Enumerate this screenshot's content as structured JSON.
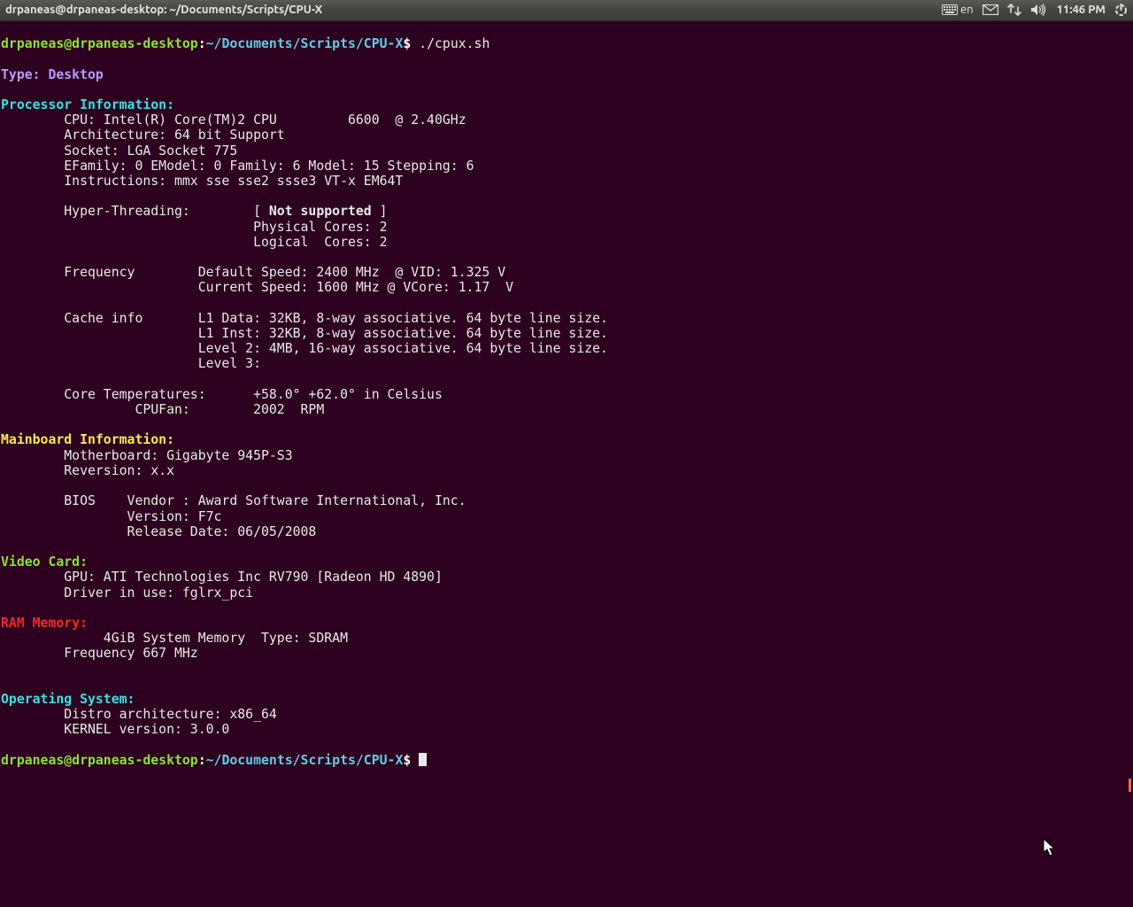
{
  "panel": {
    "title": "drpaneas@drpaneas-desktop: ~/Documents/Scripts/CPU-X",
    "kb_lang": "en",
    "time": "11:46 PM"
  },
  "prompt": {
    "user_host": "drpaneas@drpaneas-desktop",
    "colon": ":",
    "path": "~/Documents/Scripts/CPU-X",
    "dollar": "$",
    "command": "./cpux.sh"
  },
  "type_line": {
    "label": "Type: ",
    "value": "Desktop"
  },
  "proc_header": "Processor Information:",
  "proc": {
    "cpu": "        CPU: Intel(R) Core(TM)2 CPU         6600  @ 2.40GHz",
    "arch": "        Architecture: 64 bit Support",
    "socket": "        Socket: LGA Socket 775",
    "family": "        EFamily: 0 EModel: 0 Family: 6 Model: 15 Stepping: 6",
    "instr": "        Instructions: mmx sse sse2 ssse3 VT-x EM64T",
    "ht_label": "        Hyper-Threading:        [ ",
    "ht_value": "Not supported",
    "ht_close": " ]",
    "pcores": "                                Physical Cores: 2",
    "lcores": "                                Logical  Cores: 2",
    "freq1": "        Frequency        Default Speed: 2400 MHz  @ VID: 1.325 V",
    "freq2": "                         Current Speed: 1600 MHz @ VCore: 1.17  V",
    "cache1": "        Cache info       L1 Data: 32KB, 8-way associative. 64 byte line size.",
    "cache2": "                         L1 Inst: 32KB, 8-way associative. 64 byte line size.",
    "cache3": "                         Level 2: 4MB, 16-way associative. 64 byte line size.",
    "cache4": "                         Level 3:",
    "temp": "        Core Temperatures:      +58.0° +62.0° in Celsius",
    "fan": "                 CPUFan:        2002  RPM"
  },
  "mb_header": "Mainboard Information:",
  "mb": {
    "mobo": "        Motherboard: Gigabyte 945P-S3",
    "rev": "        Reversion: x.x",
    "bios": "        BIOS    Vendor : Award Software International, Inc.",
    "ver": "                Version: F7c",
    "date": "                Release Date: 06/05/2008"
  },
  "video_header": "Video Card:",
  "video": {
    "gpu": "        GPU: ATI Technologies Inc RV790 [Radeon HD 4890]",
    "driver": "        Driver in use: fglrx_pci"
  },
  "ram_header": "RAM Memory:",
  "ram": {
    "mem": "             4GiB System Memory  Type: SDRAM",
    "freq": "        Frequency 667 MHz"
  },
  "os_header": "Operating System:",
  "os": {
    "arch": "        Distro architecture: x86_64",
    "kernel": "        KERNEL version: 3.0.0"
  }
}
